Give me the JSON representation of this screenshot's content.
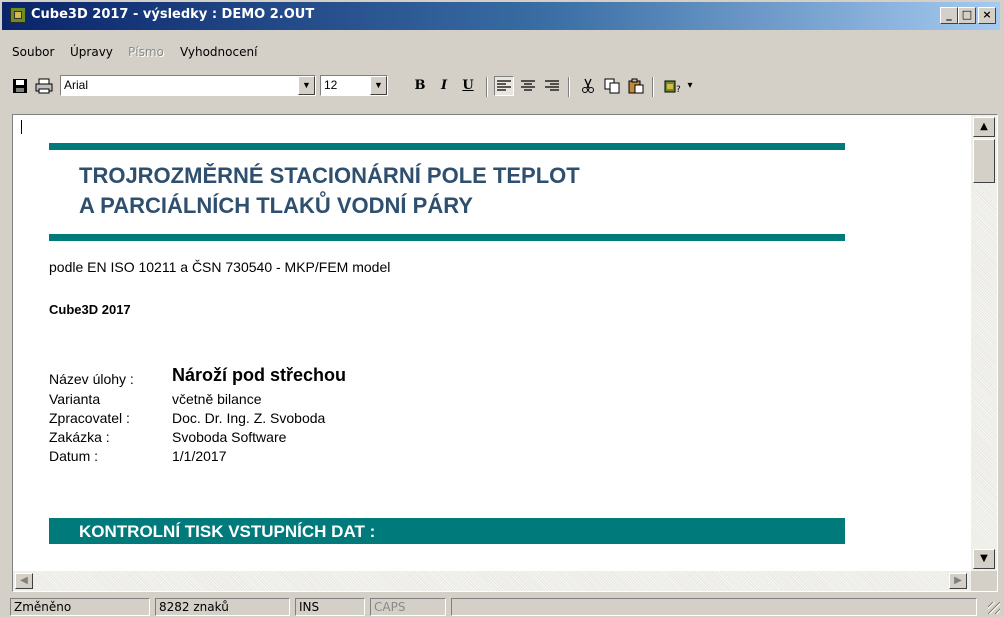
{
  "window": {
    "title": "Cube3D 2017 - výsledky : DEMO 2.OUT",
    "minimize": "_",
    "maximize": "□",
    "close": "×"
  },
  "menu": {
    "items": [
      "Soubor",
      "Úpravy",
      "Písmo",
      "Vyhodnocení"
    ],
    "disabled": [
      "Písmo"
    ]
  },
  "toolbar": {
    "font_name": "Arial",
    "font_size": "12",
    "bold_label": "B",
    "italic_label": "I",
    "underline_label": "U",
    "dropdown_arrow": "▾",
    "combo_arrow": "▼"
  },
  "document": {
    "heading_line1": "TROJROZMĚRNÉ STACIONÁRNÍ POLE TEPLOT",
    "heading_line2": "A PARCIÁLNÍCH TLAKŮ VODNÍ PÁRY",
    "standard": "podle EN ISO 10211 a ČSN 730540 - MKP/FEM model",
    "program": "Cube3D 2017",
    "fields": [
      {
        "label": "Název úlohy :",
        "value": "Nároží pod střechou"
      },
      {
        "label": "Varianta",
        "value": "včetně bilance"
      },
      {
        "label": "Zpracovatel :",
        "value": "Doc. Dr. Ing. Z. Svoboda"
      },
      {
        "label": "Zakázka :",
        "value": "Svoboda Software"
      },
      {
        "label": "Datum :",
        "value": "1/1/2017"
      }
    ],
    "section_title": "KONTROLNÍ TISK VSTUPNÍCH DAT :"
  },
  "statusbar": {
    "modified": "Změněno",
    "chars": "8282 znaků",
    "ins": "INS",
    "caps": "CAPS"
  },
  "colors": {
    "title_gradient_start": "#0a246a",
    "accent_teal": "#007a7a",
    "heading_color": "#2f4f6f"
  }
}
